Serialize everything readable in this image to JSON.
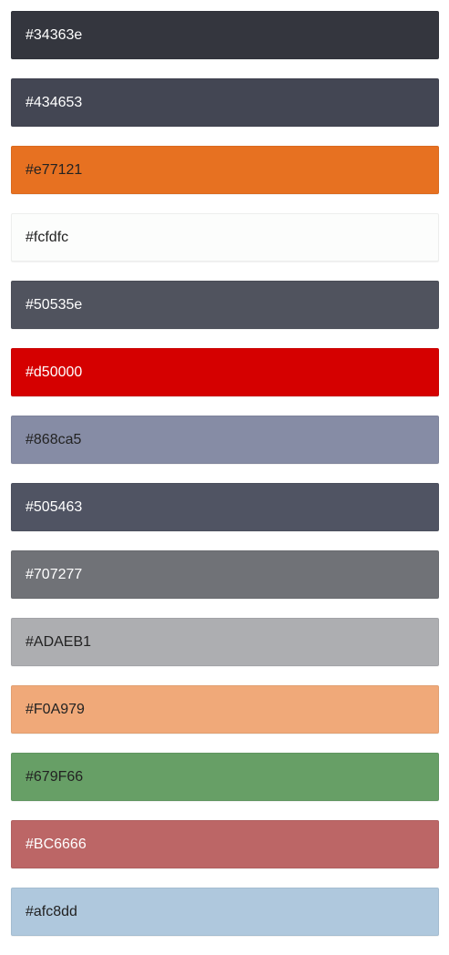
{
  "swatches": [
    {
      "label": "#34363e",
      "color": "#34363e",
      "text_color": "#ffffff"
    },
    {
      "label": "#434653",
      "color": "#434653",
      "text_color": "#ffffff"
    },
    {
      "label": "#e77121",
      "color": "#e77121",
      "text_color": "#222222"
    },
    {
      "label": "#fcfdfc",
      "color": "#fcfdfc",
      "text_color": "#222222"
    },
    {
      "label": "#50535e",
      "color": "#50535e",
      "text_color": "#ffffff"
    },
    {
      "label": "#d50000",
      "color": "#d50000",
      "text_color": "#ffffff"
    },
    {
      "label": "#868ca5",
      "color": "#868ca5",
      "text_color": "#222222"
    },
    {
      "label": "#505463",
      "color": "#505463",
      "text_color": "#ffffff"
    },
    {
      "label": "#707277",
      "color": "#707277",
      "text_color": "#ffffff"
    },
    {
      "label": "#ADAEB1",
      "color": "#ADAEB1",
      "text_color": "#222222"
    },
    {
      "label": "#F0A979",
      "color": "#F0A979",
      "text_color": "#222222"
    },
    {
      "label": "#679F66",
      "color": "#679F66",
      "text_color": "#222222"
    },
    {
      "label": "#BC6666",
      "color": "#BC6666",
      "text_color": "#ffffff"
    },
    {
      "label": "#afc8dd",
      "color": "#afc8dd",
      "text_color": "#222222"
    }
  ]
}
